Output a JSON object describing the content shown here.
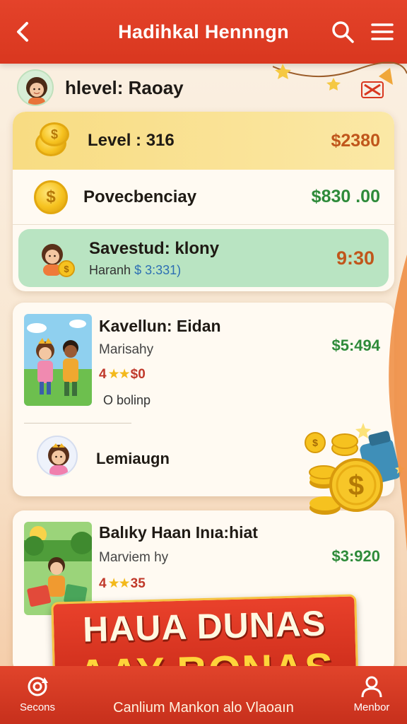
{
  "header": {
    "title": "Hadihkal Hennngn"
  },
  "user": {
    "label": "hlevel: Raoay"
  },
  "stats": {
    "level_label": "Level : 316",
    "level_value": "$2380",
    "bonus_label": "Povecbenciay",
    "bonus_value": "$830 .00",
    "saved_title": "Savestud: klony",
    "saved_sub_prefix": "Haranh",
    "saved_sub_value": "$ 3:331)",
    "saved_time": "9:30"
  },
  "tasks": [
    {
      "title": "Kavellun: Eidan",
      "subtitle": "Marisahy",
      "rating_prefix": "4",
      "stars": "★★",
      "rating_suffix": "$0",
      "amount": "$5:494",
      "extra": "O bolinp"
    },
    {
      "title": "Balıky Haan Inıa:hiat",
      "subtitle": "Marviem hy",
      "rating_prefix": "4",
      "stars": "★★",
      "rating_suffix": "35",
      "amount": "$3:920"
    }
  ],
  "member_row": {
    "name": "Lemiaugn"
  },
  "promo": {
    "line1": "HAUA DUNAS",
    "line2": "AAY BONAS"
  },
  "bottom_nav": {
    "left_label": "Secons",
    "right_label": "Menbor",
    "center_text": "Canlium Mankon alo Vlaoaın"
  },
  "colors": {
    "primary_red": "#e4432a",
    "gold": "#f6c21f",
    "green_value": "#2e8b3a",
    "orange_value": "#c0561b"
  }
}
